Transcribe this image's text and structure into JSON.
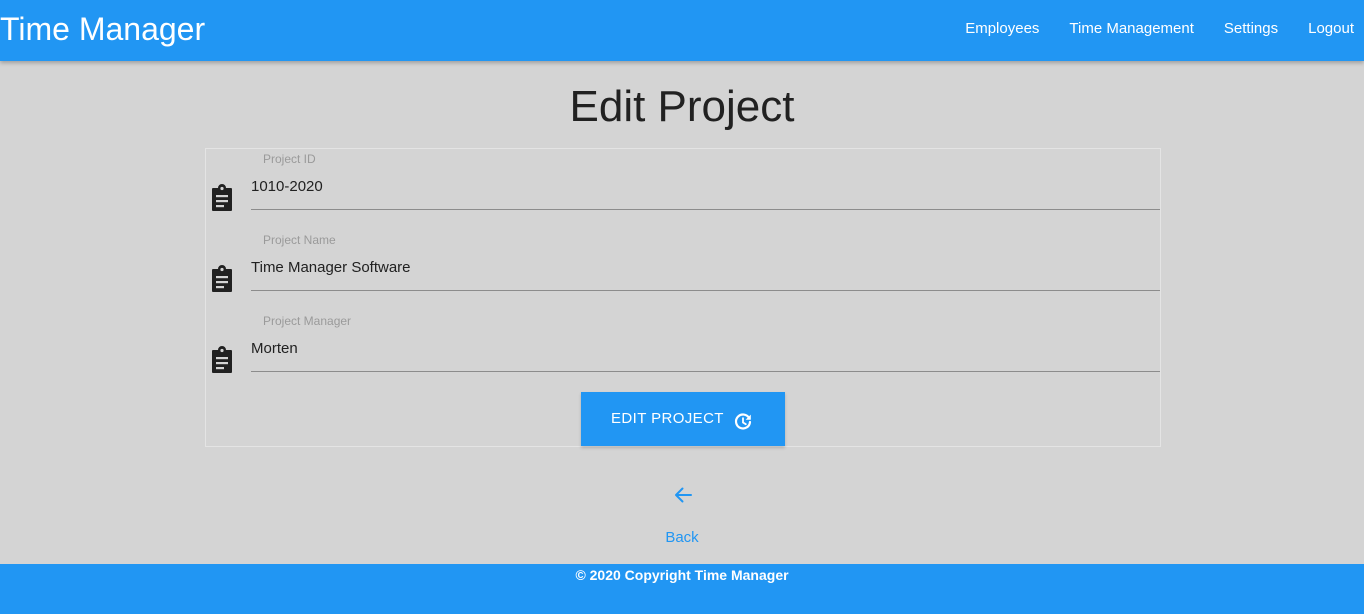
{
  "navbar": {
    "brand": "Time Manager",
    "links": [
      "Employees",
      "Time Management",
      "Settings",
      "Logout"
    ]
  },
  "page": {
    "title": "Edit Project"
  },
  "form": {
    "fields": [
      {
        "label": "Project ID",
        "value": "1010-2020",
        "icon": "clipboard-text-icon"
      },
      {
        "label": "Project Name",
        "value": "Time Manager Software",
        "icon": "clipboard-text-icon"
      },
      {
        "label": "Project Manager",
        "value": "Morten",
        "icon": "clipboard-text-icon"
      }
    ],
    "submit_label": "EDIT PROJECT",
    "submit_icon": "update-icon"
  },
  "back": {
    "label": "Back",
    "icon": "arrow-left-icon"
  },
  "footer": {
    "text": "© 2020 Copyright Time Manager"
  },
  "colors": {
    "primary": "#2196f3",
    "background": "#d4d4d4",
    "text": "#212121"
  }
}
